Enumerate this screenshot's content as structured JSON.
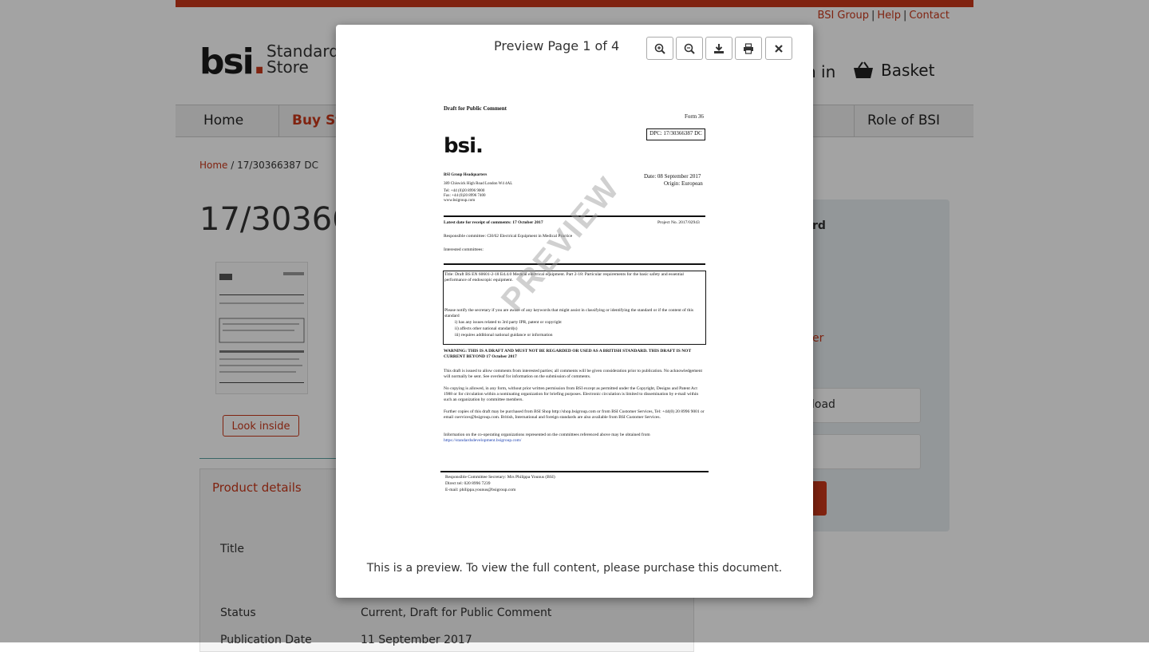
{
  "toplinks": {
    "bsi_group": "BSI Group",
    "help": "Help",
    "contact": "Contact",
    "sep": "|"
  },
  "logo": {
    "bsi": "bsi",
    "dot": ".",
    "standards": "Standards",
    "store": "Store"
  },
  "header": {
    "signin": "n in",
    "basket": "Basket"
  },
  "nav": {
    "home": "Home",
    "buy": "Buy Sta",
    "role": "Role of BSI"
  },
  "breadcrumb": {
    "home": "Home",
    "sep": "/",
    "current": "17/30366387 DC"
  },
  "page_title": "17/30366",
  "look_inside": "Look inside",
  "details": {
    "heading": "Product details",
    "title_label": "Title",
    "status_label": "Status",
    "status_value": "Current, Draft for Public Comment",
    "pubdate_label": "Publication Date",
    "pubdate_value": "11 September 2017"
  },
  "side": {
    "rd": "rd",
    "er": "er",
    "load": "load",
    "dot": "."
  },
  "modal": {
    "title": "Preview Page 1 of 4",
    "note": "This is a preview. To view the full content, please purchase this document.",
    "watermark": "PREVIEW"
  },
  "doc": {
    "draft": "Draft for Public Comment",
    "form": "Form 36",
    "dpc": "DPC: 17/30366387 DC",
    "logo": "bsi.",
    "hq": "BSI Group Headquarters",
    "addr": "389 Chiswick High Road London W4 4AL",
    "tel": "Tel: +44 (0)20 8996 9000",
    "fax": "Fax: +44 (0)20 8996 7400",
    "web": "www.bsigroup.com",
    "date": "Date: 08 September 2017",
    "origin": "Origin: European",
    "latest": "Latest date for receipt of comments: 17 October 2017",
    "project": "Project No. 2017/02943",
    "committee": "Responsible committee: CH/62 Electrical Equipment in Medical Practice",
    "interested": "Interested committees:",
    "box_title": "Title: Draft BS EN 60601-2-18 Ed.4.0 Medical electrical equipment. Part 2-18: Particular requirements for the basic safety and essential performance of endoscopic equipment.",
    "notify": "Please notify the secretary if you are aware of any keywords that might assist in classifying or identifying the standard or if the content of this standard",
    "i1": "i)      has any issues related to 3rd party IPR, patent or copyright",
    "i2": "ii)     affects other national standard(s)",
    "i3": "iii)    requires additional national guidance or information",
    "warning": "WARNING: THIS IS A DRAFT AND MUST NOT BE REGARDED OR USED AS A BRITISH STANDARD. THIS DRAFT IS NOT CURRENT BEYOND 17 October 2017",
    "p1": "This draft is issued to allow comments from interested parties; all comments will be given consideration prior to publication. No acknowledgement will normally be sent. See overleaf for information on the submission of comments.",
    "p2": "No copying is allowed, in any form, without prior written permission from BSI except as permitted under the Copyright, Designs and Patent Act 1988 or for circulation within a nominating organization for briefing purposes. Electronic circulation is limited to dissemination by e-mail within such an organization by committee members.",
    "p3": "Further copies of this draft may be purchased from BSI Shop http://shop.bsigroup.com or from BSI Customer Services, Tel: +44(0) 20 8996 9001 or email cservices@bsigroup.com. British, International and foreign standards are also available from BSI Customer Services.",
    "p4": "Information on the co-operating organizations represented on the committees referenced above may be obtained from",
    "p4link": "https://standardsdevelopment.bsigroup.com/",
    "sec": "Responsible Committee Secretary: Mrs Philippa Younus (BSI)",
    "dial": "Direct tel: 020 8996 7239",
    "email": "E-mail: philippa.younus@bsigroup.com"
  },
  "icons": [
    "zoom-in-icon",
    "zoom-out-icon",
    "download-icon",
    "print-icon",
    "close-icon",
    "chevron-right-icon",
    "basket-icon"
  ],
  "colors": {
    "brand": "#c8371a",
    "overlay": "rgba(0,0,0,0.36)"
  }
}
